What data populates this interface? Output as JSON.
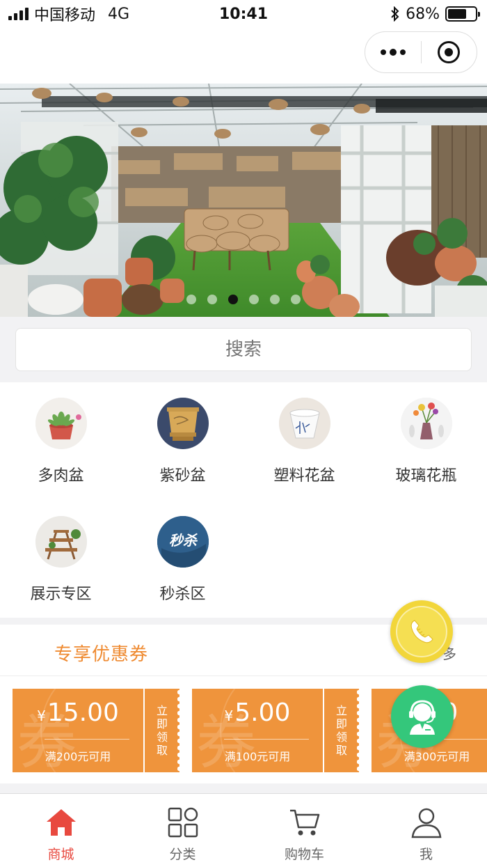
{
  "status_bar": {
    "carrier": "中国移动",
    "network": "4G",
    "time": "10:41",
    "battery_percent": "68%",
    "battery_level": 0.68,
    "icons": [
      "signal-icon",
      "bluetooth-icon",
      "battery-icon"
    ]
  },
  "nav": {
    "capsule_icons": [
      "more-icon",
      "close-miniprogram-icon"
    ]
  },
  "banner": {
    "slide_count": 6,
    "active_index": 2
  },
  "search": {
    "placeholder": "搜索"
  },
  "categories": [
    {
      "label": "多肉盆",
      "icon": "succulent-pot-image"
    },
    {
      "label": "紫砂盆",
      "icon": "clay-pot-image"
    },
    {
      "label": "塑料花盆",
      "icon": "plastic-pot-image"
    },
    {
      "label": "玻璃花瓶",
      "icon": "glass-vase-image"
    },
    {
      "label": "展示专区",
      "icon": "display-stand-image"
    },
    {
      "label": "秒杀区",
      "icon": "flash-sale-image",
      "badge_text": "秒杀"
    }
  ],
  "coupons": {
    "title": "专享优惠券",
    "more_label": "多",
    "watermark": "券",
    "claim_label": "立即领取",
    "currency": "¥",
    "items": [
      {
        "amount": "15.00",
        "condition": "满200元可用"
      },
      {
        "amount": "5.00",
        "condition": "满100元可用"
      },
      {
        "amount": "00",
        "condition": "满300元可用"
      }
    ]
  },
  "tab_bar": {
    "active_color": "#e8493f",
    "items": [
      {
        "label": "商城",
        "icon": "home-icon",
        "active": true
      },
      {
        "label": "分类",
        "icon": "category-grid-icon",
        "active": false
      },
      {
        "label": "购物车",
        "icon": "cart-icon",
        "active": false
      },
      {
        "label": "我",
        "icon": "user-icon",
        "active": false
      }
    ]
  },
  "floating": {
    "phone_icon": "phone-call-icon",
    "service_icon": "customer-service-icon"
  },
  "colors": {
    "coupon_orange": "#ef943c",
    "title_orange": "#ef8a30",
    "service_green": "#34c77b",
    "phone_yellow": "#f2d63a"
  }
}
